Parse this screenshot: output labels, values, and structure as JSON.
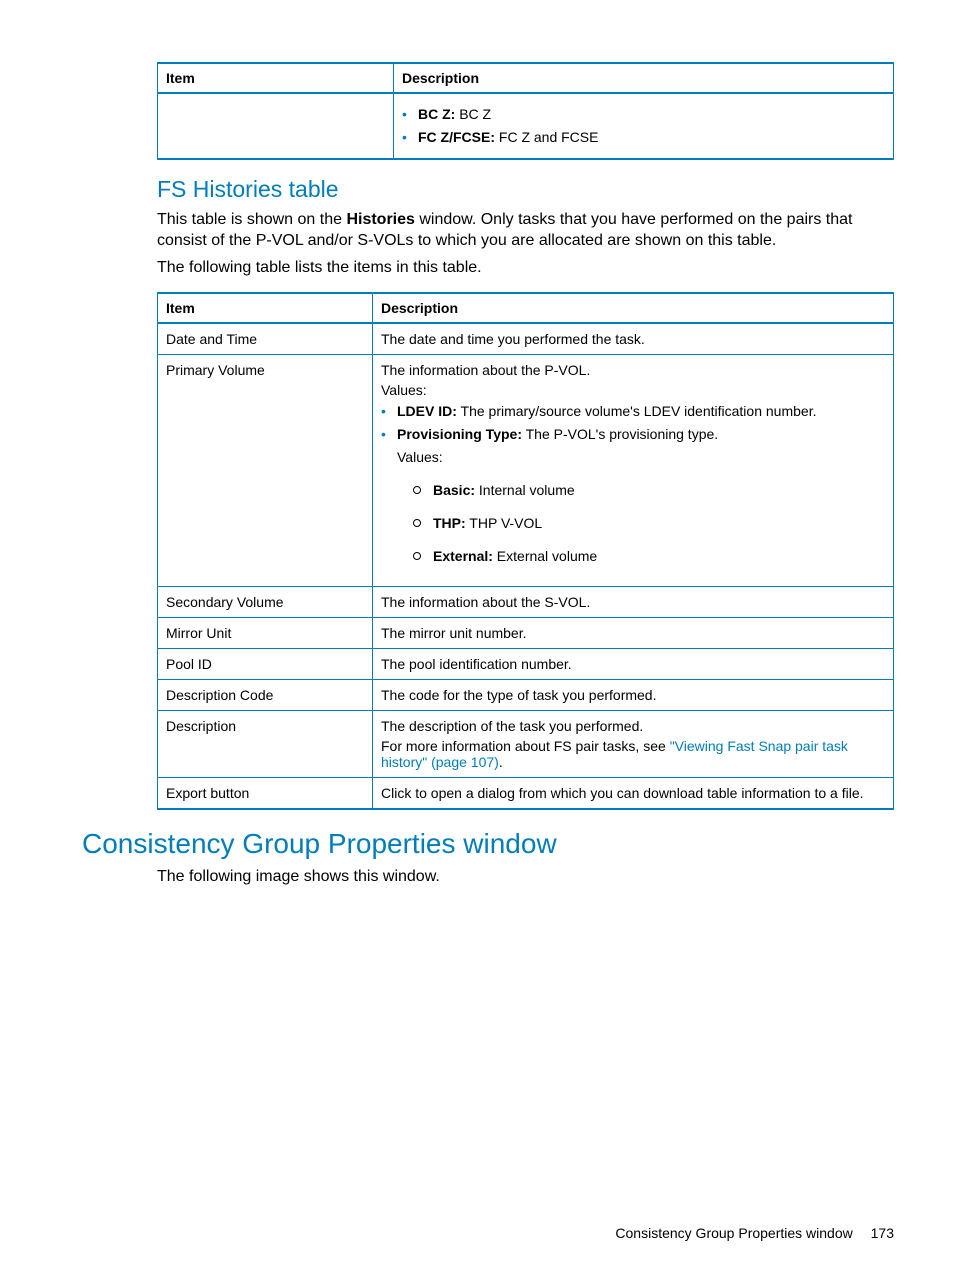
{
  "table1": {
    "headers": {
      "item": "Item",
      "desc": "Description"
    },
    "row": {
      "bcz_label": "BC Z:",
      "bcz_val": " BC Z",
      "fcz_label": "FC Z/FCSE:",
      "fcz_val": " FC Z and FCSE"
    }
  },
  "fs_histories": {
    "heading": "FS Histories table",
    "para1_a": "This table is shown on the ",
    "para1_b_bold": "Histories",
    "para1_c": " window. Only tasks that you have performed on the pairs that consist of the P-VOL and/or S-VOLs to which you are allocated are shown on this table.",
    "para2": "The following table lists the items in this table."
  },
  "table2": {
    "headers": {
      "item": "Item",
      "desc": "Description"
    },
    "rows": {
      "date_time": {
        "item": "Date and Time",
        "desc": "The date and time you performed the task."
      },
      "primary_volume": {
        "item": "Primary Volume",
        "intro": "The information about the P-VOL.",
        "values_label": "Values:",
        "ldev_label": "LDEV ID:",
        "ldev_text": " The primary/source volume's LDEV identification number.",
        "prov_label": "Provisioning Type:",
        "prov_text": " The P-VOL's provisioning type.",
        "prov_values_label": "Values:",
        "basic_label": "Basic:",
        "basic_text": " Internal volume",
        "thp_label": "THP:",
        "thp_text": " THP V-VOL",
        "external_label": "External:",
        "external_text": " External volume"
      },
      "secondary_volume": {
        "item": "Secondary Volume",
        "desc": "The information about the S-VOL."
      },
      "mirror_unit": {
        "item": "Mirror Unit",
        "desc": "The mirror unit number."
      },
      "pool_id": {
        "item": "Pool ID",
        "desc": "The pool identification number."
      },
      "description_code": {
        "item": "Description Code",
        "desc": "The code for the type of task you performed."
      },
      "description": {
        "item": "Description",
        "line1": "The description of the task you performed.",
        "line2a": "For more information about FS pair tasks, see ",
        "link": "\"Viewing Fast Snap pair task history\" (page 107)",
        "line2b": "."
      },
      "export": {
        "item": "Export button",
        "desc": "Click to open a dialog from which you can download table information to a file."
      }
    }
  },
  "cgp": {
    "heading": "Consistency Group Properties window",
    "para": "The following image shows this window."
  },
  "footer": {
    "text": "Consistency Group Properties window",
    "page": "173"
  }
}
